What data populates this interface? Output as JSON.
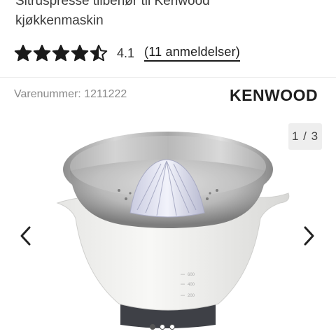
{
  "product": {
    "title_line1": "Sitruspresse tilbehør til Kenwood",
    "title_line2": "kjøkkenmaskin",
    "rating": {
      "value": "4.1",
      "score": 4.1,
      "max": 5,
      "reviews_label": "(11 anmeldelser)"
    },
    "sku": "Varenummer: 1211222",
    "brand": "KENWOOD"
  },
  "gallery": {
    "counter": "1 / 3",
    "current": 1,
    "total": 3,
    "bowl_markings": [
      "600",
      "400",
      "200"
    ]
  },
  "icons": {
    "prev": "chevron-left-icon",
    "next": "chevron-right-icon",
    "star": "star-icon"
  },
  "colors": {
    "star": "#1a1a1a",
    "text": "#333333",
    "muted": "#8a8a8a"
  }
}
